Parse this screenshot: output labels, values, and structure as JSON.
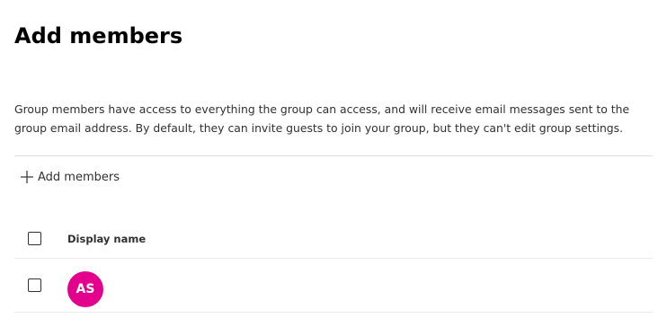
{
  "header": {
    "title": "Add members"
  },
  "description": "Group members have access to everything the group can access, and will receive email messages sent to the group email address. By default, they can invite guests to join your group, but they can't edit group settings.",
  "toolbar": {
    "add_members_label": "Add members",
    "add_icon": "plus-icon"
  },
  "table": {
    "columns": [
      {
        "label": "Display name"
      }
    ],
    "rows": [
      {
        "avatar_initials": "AS",
        "avatar_color": "#e3008c",
        "display_name": ""
      }
    ]
  },
  "colors": {
    "divider": "#e1dfdd",
    "text": "#323130",
    "title": "#000000"
  }
}
